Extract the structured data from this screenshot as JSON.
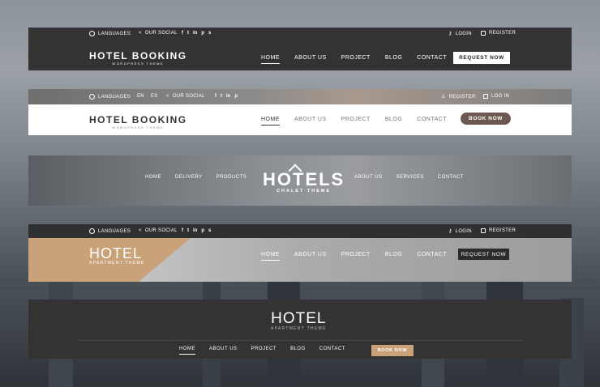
{
  "h1": {
    "top_left": {
      "languages": "LANGUAGES",
      "social": "OUR SOCIAL",
      "social_icons": [
        "f",
        "t",
        "in",
        "p",
        "s"
      ]
    },
    "top_right": {
      "login": "LOGIN",
      "register": "REGISTER"
    },
    "logo": "HOTEL BOOKING",
    "logo_sub": "WORDPRESS THEME",
    "nav": [
      "HOME",
      "ABOUT US",
      "PROJECT",
      "BLOG",
      "CONTACT"
    ],
    "cta": "REQUEST NOW"
  },
  "h2": {
    "top_left": {
      "languages": "LANGUAGES",
      "lang_en": "EN",
      "lang_es": "ES",
      "social": "OUR SOCIAL",
      "social_icons": [
        "f",
        "t",
        "in",
        "p"
      ]
    },
    "top_right": {
      "register": "REGISTER",
      "login": "LOG IN"
    },
    "logo": "HOTEL BOOKING",
    "logo_sub": "WORDPRESS THEME",
    "nav": [
      "HOME",
      "ABOUT US",
      "PROJECT",
      "BLOG",
      "CONTACT"
    ],
    "cta": "BOOK NOW"
  },
  "h3": {
    "nav_left": [
      "HOME",
      "DELIVERY",
      "PRODUCTS"
    ],
    "logo": "HOTELS",
    "logo_sub": "CHALET THEME",
    "nav_right": [
      "ABOUT US",
      "SERVICES",
      "CONTACT"
    ]
  },
  "h4": {
    "top_left": {
      "languages": "LANGUAGES",
      "social": "OUR SOCIAL",
      "social_icons": [
        "f",
        "t",
        "in",
        "p",
        "s"
      ]
    },
    "top_right": {
      "login": "LOGIN",
      "register": "REGISTER"
    },
    "logo": "HOTEL",
    "logo_sub": "APARTMENT THEME",
    "nav": [
      "HOME",
      "ABOUT US",
      "PROJECT",
      "BLOG",
      "CONTACT"
    ],
    "cta": "REQUEST NOW"
  },
  "h5": {
    "logo": "HOTEL",
    "logo_sub": "APARTMENT THEME",
    "nav": [
      "HOME",
      "ABOUT US",
      "PROJECT",
      "BLOG",
      "CONTACT"
    ],
    "cta": "BOOK NOW"
  },
  "colors": {
    "dark": "#333333",
    "accent_tan": "#c9a27a",
    "button_brown": "#6e5751",
    "white": "#ffffff"
  }
}
